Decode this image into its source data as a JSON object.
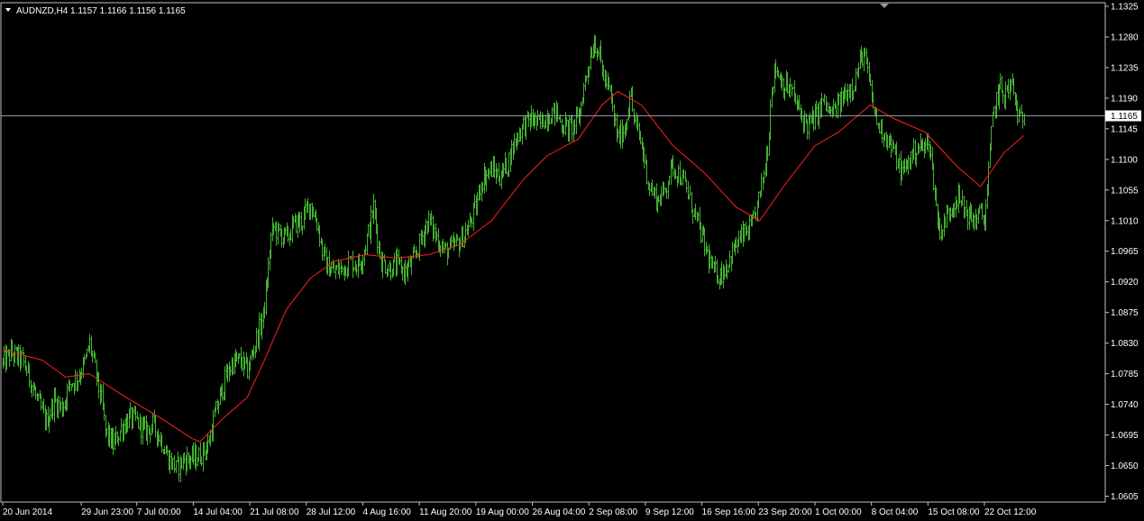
{
  "header": {
    "symbol_text": "AUDNZD,H4  1.1157 1.1166 1.1156 1.1165",
    "menu_icon": "triangle-down-icon"
  },
  "colors": {
    "background": "#000000",
    "frame": "#c0c0c0",
    "bars": "#43b131",
    "moving_average": "#ff2020",
    "current_price_line": "#8c9aa8",
    "price_tag_bg": "#ffffff"
  },
  "chart_data": {
    "type": "ohlc",
    "symbol": "AUDNZD",
    "timeframe": "H4",
    "current_price": 1.1165,
    "current_price_label": "1.1165",
    "ylim": [
      1.0603,
      1.1325
    ],
    "y_ticks": [
      {
        "value": 1.1325,
        "label": "1.1325"
      },
      {
        "value": 1.128,
        "label": "1.1280"
      },
      {
        "value": 1.1235,
        "label": "1.1235"
      },
      {
        "value": 1.119,
        "label": "1.1190"
      },
      {
        "value": 1.1145,
        "label": "1.1145"
      },
      {
        "value": 1.11,
        "label": "1.1100"
      },
      {
        "value": 1.1055,
        "label": "1.1055"
      },
      {
        "value": 1.101,
        "label": "1.1010"
      },
      {
        "value": 1.0965,
        "label": "1.0965"
      },
      {
        "value": 1.092,
        "label": "1.0920"
      },
      {
        "value": 1.0875,
        "label": "1.0875"
      },
      {
        "value": 1.083,
        "label": "1.0830"
      },
      {
        "value": 1.0785,
        "label": "1.0785"
      },
      {
        "value": 1.074,
        "label": "1.0740"
      },
      {
        "value": 1.0695,
        "label": "1.0695"
      },
      {
        "value": 1.065,
        "label": "1.0650"
      },
      {
        "value": 1.0605,
        "label": "1.0605"
      }
    ],
    "x_range": [
      "20 Jun 2014",
      "27 Oct 2014"
    ],
    "x_ticks": [
      {
        "date": "2014-06-20T00:00",
        "label": "20 Jun 2014"
      },
      {
        "date": "2014-06-29T23:00",
        "label": "29 Jun 23:00"
      },
      {
        "date": "2014-07-07T00:00",
        "label": "7 Jul 00:00"
      },
      {
        "date": "2014-07-14T04:00",
        "label": "14 Jul 04:00"
      },
      {
        "date": "2014-07-21T08:00",
        "label": "21 Jul 08:00"
      },
      {
        "date": "2014-07-28T12:00",
        "label": "28 Jul 12:00"
      },
      {
        "date": "2014-08-04T16:00",
        "label": "4 Aug 16:00"
      },
      {
        "date": "2014-08-11T20:00",
        "label": "11 Aug 20:00"
      },
      {
        "date": "2014-08-19T00:00",
        "label": "19 Aug 00:00"
      },
      {
        "date": "2014-08-26T04:00",
        "label": "26 Aug 04:00"
      },
      {
        "date": "2014-09-02T08:00",
        "label": "2 Sep 08:00"
      },
      {
        "date": "2014-09-09T12:00",
        "label": "9 Sep 12:00"
      },
      {
        "date": "2014-09-16T16:00",
        "label": "16 Sep 16:00"
      },
      {
        "date": "2014-09-23T20:00",
        "label": "23 Sep 20:00"
      },
      {
        "date": "2014-10-01T00:00",
        "label": "1 Oct 00:00"
      },
      {
        "date": "2014-10-08T04:00",
        "label": "8 Oct 04:00"
      },
      {
        "date": "2014-10-15T08:00",
        "label": "15 Oct 08:00"
      },
      {
        "date": "2014-10-22T12:00",
        "label": "22 Oct 12:00"
      }
    ],
    "price_path": [
      [
        "2014-06-20T00:00",
        1.08
      ],
      [
        "2014-06-21T00:00",
        1.0815
      ],
      [
        "2014-06-22T12:00",
        1.0805
      ],
      [
        "2014-06-23T12:00",
        1.0775
      ],
      [
        "2014-06-24T12:00",
        1.074
      ],
      [
        "2014-06-25T12:00",
        1.0715
      ],
      [
        "2014-06-26T12:00",
        1.0745
      ],
      [
        "2014-06-27T12:00",
        1.0735
      ],
      [
        "2014-06-28T12:00",
        1.077
      ],
      [
        "2014-06-29T12:00",
        1.078
      ],
      [
        "2014-06-30T12:00",
        1.0805
      ],
      [
        "2014-07-01T00:00",
        1.083
      ],
      [
        "2014-07-01T16:00",
        1.079
      ],
      [
        "2014-07-02T12:00",
        1.0745
      ],
      [
        "2014-07-03T00:00",
        1.07
      ],
      [
        "2014-07-04T00:00",
        1.068
      ],
      [
        "2014-07-05T00:00",
        1.0705
      ],
      [
        "2014-07-06T00:00",
        1.072
      ],
      [
        "2014-07-07T00:00",
        1.0715
      ],
      [
        "2014-07-08T00:00",
        1.07
      ],
      [
        "2014-07-09T00:00",
        1.071
      ],
      [
        "2014-07-10T00:00",
        1.069
      ],
      [
        "2014-07-11T00:00",
        1.066
      ],
      [
        "2014-07-12T00:00",
        1.0645
      ],
      [
        "2014-07-13T00:00",
        1.066
      ],
      [
        "2014-07-14T04:00",
        1.066
      ],
      [
        "2014-07-15T00:00",
        1.0665
      ],
      [
        "2014-07-16T00:00",
        1.068
      ],
      [
        "2014-07-17T00:00",
        1.073
      ],
      [
        "2014-07-18T00:00",
        1.077
      ],
      [
        "2014-07-19T00:00",
        1.08
      ],
      [
        "2014-07-20T00:00",
        1.0805
      ],
      [
        "2014-07-21T00:00",
        1.079
      ],
      [
        "2014-07-22T00:00",
        1.083
      ],
      [
        "2014-07-23T00:00",
        1.087
      ],
      [
        "2014-07-23T12:00",
        1.092
      ],
      [
        "2014-07-24T00:00",
        1.0985
      ],
      [
        "2014-07-24T08:00",
        1.1
      ],
      [
        "2014-07-25T00:00",
        1.099
      ],
      [
        "2014-07-26T00:00",
        1.0985
      ],
      [
        "2014-07-27T00:00",
        1.1005
      ],
      [
        "2014-07-28T00:00",
        1.101
      ],
      [
        "2014-07-28T12:00",
        1.1025
      ],
      [
        "2014-07-29T00:00",
        1.1035
      ],
      [
        "2014-07-30T00:00",
        1.1
      ],
      [
        "2014-07-30T12:00",
        1.0965
      ],
      [
        "2014-07-31T00:00",
        1.0945
      ],
      [
        "2014-08-01T00:00",
        1.0935
      ],
      [
        "2014-08-02T00:00",
        1.094
      ],
      [
        "2014-08-03T00:00",
        1.095
      ],
      [
        "2014-08-04T00:00",
        1.0945
      ],
      [
        "2014-08-04T16:00",
        1.096
      ],
      [
        "2014-08-05T12:00",
        1.1
      ],
      [
        "2014-08-06T00:00",
        1.103
      ],
      [
        "2014-08-06T12:00",
        1.0985
      ],
      [
        "2014-08-07T00:00",
        1.095
      ],
      [
        "2014-08-08T00:00",
        1.094
      ],
      [
        "2014-08-09T00:00",
        1.0945
      ],
      [
        "2014-08-10T00:00",
        1.0935
      ],
      [
        "2014-08-11T00:00",
        1.095
      ],
      [
        "2014-08-11T20:00",
        1.0975
      ],
      [
        "2014-08-12T12:00",
        1.1
      ],
      [
        "2014-08-13T00:00",
        1.101
      ],
      [
        "2014-08-14T00:00",
        1.0985
      ],
      [
        "2014-08-15T00:00",
        1.0965
      ],
      [
        "2014-08-16T00:00",
        1.097
      ],
      [
        "2014-08-17T00:00",
        1.098
      ],
      [
        "2014-08-18T00:00",
        1.1
      ],
      [
        "2014-08-19T00:00",
        1.103
      ],
      [
        "2014-08-19T12:00",
        1.106
      ],
      [
        "2014-08-20T00:00",
        1.1075
      ],
      [
        "2014-08-21T00:00",
        1.1085
      ],
      [
        "2014-08-22T00:00",
        1.1075
      ],
      [
        "2014-08-23T00:00",
        1.1095
      ],
      [
        "2014-08-24T00:00",
        1.113
      ],
      [
        "2014-08-25T00:00",
        1.115
      ],
      [
        "2014-08-26T04:00",
        1.116
      ],
      [
        "2014-08-27T00:00",
        1.115
      ],
      [
        "2014-08-28T00:00",
        1.1165
      ],
      [
        "2014-08-29T00:00",
        1.117
      ],
      [
        "2014-08-30T00:00",
        1.115
      ],
      [
        "2014-08-31T00:00",
        1.1145
      ],
      [
        "2014-09-01T00:00",
        1.116
      ],
      [
        "2014-09-01T12:00",
        1.1195
      ],
      [
        "2014-09-02T00:00",
        1.1225
      ],
      [
        "2014-09-02T12:00",
        1.1255
      ],
      [
        "2014-09-03T00:00",
        1.1275
      ],
      [
        "2014-09-03T12:00",
        1.126
      ],
      [
        "2014-09-04T00:00",
        1.123
      ],
      [
        "2014-09-05T00:00",
        1.1195
      ],
      [
        "2014-09-05T12:00",
        1.116
      ],
      [
        "2014-09-06T00:00",
        1.113
      ],
      [
        "2014-09-07T00:00",
        1.115
      ],
      [
        "2014-09-07T12:00",
        1.12
      ],
      [
        "2014-09-08T00:00",
        1.116
      ],
      [
        "2014-09-09T00:00",
        1.112
      ],
      [
        "2014-09-09T12:00",
        1.109
      ],
      [
        "2014-09-10T00:00",
        1.106
      ],
      [
        "2014-09-11T00:00",
        1.104
      ],
      [
        "2014-09-12T00:00",
        1.1055
      ],
      [
        "2014-09-12T12:00",
        1.108
      ],
      [
        "2014-09-13T00:00",
        1.109
      ],
      [
        "2014-09-14T00:00",
        1.1075
      ],
      [
        "2014-09-15T00:00",
        1.1045
      ],
      [
        "2014-09-16T00:00",
        1.101
      ],
      [
        "2014-09-16T16:00",
        1.0985
      ],
      [
        "2014-09-17T12:00",
        1.0955
      ],
      [
        "2014-09-18T00:00",
        1.0935
      ],
      [
        "2014-09-19T00:00",
        1.093
      ],
      [
        "2014-09-20T00:00",
        1.095
      ],
      [
        "2014-09-21T00:00",
        1.0975
      ],
      [
        "2014-09-22T00:00",
        1.099
      ],
      [
        "2014-09-23T00:00",
        1.1
      ],
      [
        "2014-09-23T20:00",
        1.104
      ],
      [
        "2014-09-24T12:00",
        1.108
      ],
      [
        "2014-09-25T00:00",
        1.112
      ],
      [
        "2014-09-25T12:00",
        1.121
      ],
      [
        "2014-09-26T00:00",
        1.1235
      ],
      [
        "2014-09-27T00:00",
        1.121
      ],
      [
        "2014-09-28T00:00",
        1.12
      ],
      [
        "2014-09-29T00:00",
        1.117
      ],
      [
        "2014-09-30T00:00",
        1.115
      ],
      [
        "2014-10-01T00:00",
        1.116
      ],
      [
        "2014-10-02T00:00",
        1.1185
      ],
      [
        "2014-10-03T00:00",
        1.1165
      ],
      [
        "2014-10-04T00:00",
        1.118
      ],
      [
        "2014-10-05T00:00",
        1.12
      ],
      [
        "2014-10-06T00:00",
        1.1215
      ],
      [
        "2014-10-07T00:00",
        1.1255
      ],
      [
        "2014-10-07T12:00",
        1.124
      ],
      [
        "2014-10-08T00:00",
        1.12
      ],
      [
        "2014-10-08T12:00",
        1.117
      ],
      [
        "2014-10-09T00:00",
        1.115
      ],
      [
        "2014-10-10T00:00",
        1.1135
      ],
      [
        "2014-10-11T00:00",
        1.111
      ],
      [
        "2014-10-12T00:00",
        1.108
      ],
      [
        "2014-10-13T00:00",
        1.11
      ],
      [
        "2014-10-14T00:00",
        1.112
      ],
      [
        "2014-10-15T00:00",
        1.1115
      ],
      [
        "2014-10-15T08:00",
        1.1135
      ],
      [
        "2014-10-16T00:00",
        1.107
      ],
      [
        "2014-10-16T12:00",
        1.101
      ],
      [
        "2014-10-17T00:00",
        1.0995
      ],
      [
        "2014-10-18T00:00",
        1.1025
      ],
      [
        "2014-10-19T00:00",
        1.1045
      ],
      [
        "2014-10-20T00:00",
        1.1025
      ],
      [
        "2014-10-21T00:00",
        1.101
      ],
      [
        "2014-10-22T00:00",
        1.102
      ],
      [
        "2014-10-22T12:00",
        1.101
      ],
      [
        "2014-10-23T00:00",
        1.108
      ],
      [
        "2014-10-23T12:00",
        1.116
      ],
      [
        "2014-10-24T00:00",
        1.119
      ],
      [
        "2014-10-24T12:00",
        1.1205
      ],
      [
        "2014-10-25T00:00",
        1.1195
      ],
      [
        "2014-10-26T00:00",
        1.121
      ],
      [
        "2014-10-26T12:00",
        1.1175
      ],
      [
        "2014-10-27T00:00",
        1.1155
      ],
      [
        "2014-10-27T12:00",
        1.1165
      ]
    ],
    "moving_average_path": [
      [
        "2014-06-20T00:00",
        1.082
      ],
      [
        "2014-06-25T00:00",
        1.0805
      ],
      [
        "2014-06-28T00:00",
        1.078
      ],
      [
        "2014-07-01T00:00",
        1.0785
      ],
      [
        "2014-07-05T00:00",
        1.0755
      ],
      [
        "2014-07-10T00:00",
        1.072
      ],
      [
        "2014-07-14T00:00",
        1.069
      ],
      [
        "2014-07-15T00:00",
        1.0685
      ],
      [
        "2014-07-18T00:00",
        1.072
      ],
      [
        "2014-07-21T00:00",
        1.075
      ],
      [
        "2014-07-23T00:00",
        1.08
      ],
      [
        "2014-07-26T00:00",
        1.088
      ],
      [
        "2014-07-29T00:00",
        1.0925
      ],
      [
        "2014-08-01T00:00",
        1.095
      ],
      [
        "2014-08-05T00:00",
        1.096
      ],
      [
        "2014-08-09T00:00",
        1.0955
      ],
      [
        "2014-08-13T00:00",
        1.096
      ],
      [
        "2014-08-17T00:00",
        1.0975
      ],
      [
        "2014-08-21T00:00",
        1.101
      ],
      [
        "2014-08-25T00:00",
        1.107
      ],
      [
        "2014-08-28T00:00",
        1.1105
      ],
      [
        "2014-09-01T00:00",
        1.113
      ],
      [
        "2014-09-04T00:00",
        1.118
      ],
      [
        "2014-09-06T00:00",
        1.12
      ],
      [
        "2014-09-09T00:00",
        1.118
      ],
      [
        "2014-09-13T00:00",
        1.112
      ],
      [
        "2014-09-17T00:00",
        1.108
      ],
      [
        "2014-09-21T00:00",
        1.103
      ],
      [
        "2014-09-24T00:00",
        1.101
      ],
      [
        "2014-09-27T00:00",
        1.106
      ],
      [
        "2014-10-01T00:00",
        1.112
      ],
      [
        "2014-10-04T00:00",
        1.114
      ],
      [
        "2014-10-08T00:00",
        1.118
      ],
      [
        "2014-10-11T00:00",
        1.116
      ],
      [
        "2014-10-15T00:00",
        1.114
      ],
      [
        "2014-10-19T00:00",
        1.109
      ],
      [
        "2014-10-22T00:00",
        1.106
      ],
      [
        "2014-10-25T00:00",
        1.111
      ],
      [
        "2014-10-27T12:00",
        1.1135
      ]
    ]
  }
}
